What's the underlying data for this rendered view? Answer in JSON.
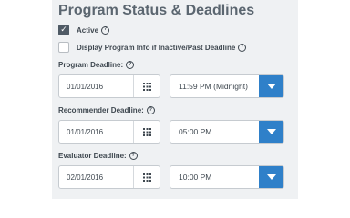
{
  "section": {
    "title": "Program Status & Deadlines"
  },
  "checkboxes": [
    {
      "label": "Active",
      "checked": true,
      "has_help": true
    },
    {
      "label": "Display Program Info if Inactive/Past Deadline",
      "checked": false,
      "has_help": true
    }
  ],
  "fields": [
    {
      "label": "Program Deadline:",
      "date": "01/01/2016",
      "time": "11:59 PM (Midnight)"
    },
    {
      "label": "Recommender Deadline:",
      "date": "01/01/2016",
      "time": "05:00 PM"
    },
    {
      "label": "Evaluator Deadline:",
      "date": "02/01/2016",
      "time": "10:00 PM"
    }
  ],
  "icons": {
    "help": "help-circle-icon",
    "calendar": "calendar-grid-icon",
    "dropdown": "caret-down-icon"
  },
  "colors": {
    "panel_bg": "#eff1f3",
    "title": "#5b6670",
    "checkbox_checked": "#4f5a65",
    "dropdown_button": "#2f80c9"
  }
}
